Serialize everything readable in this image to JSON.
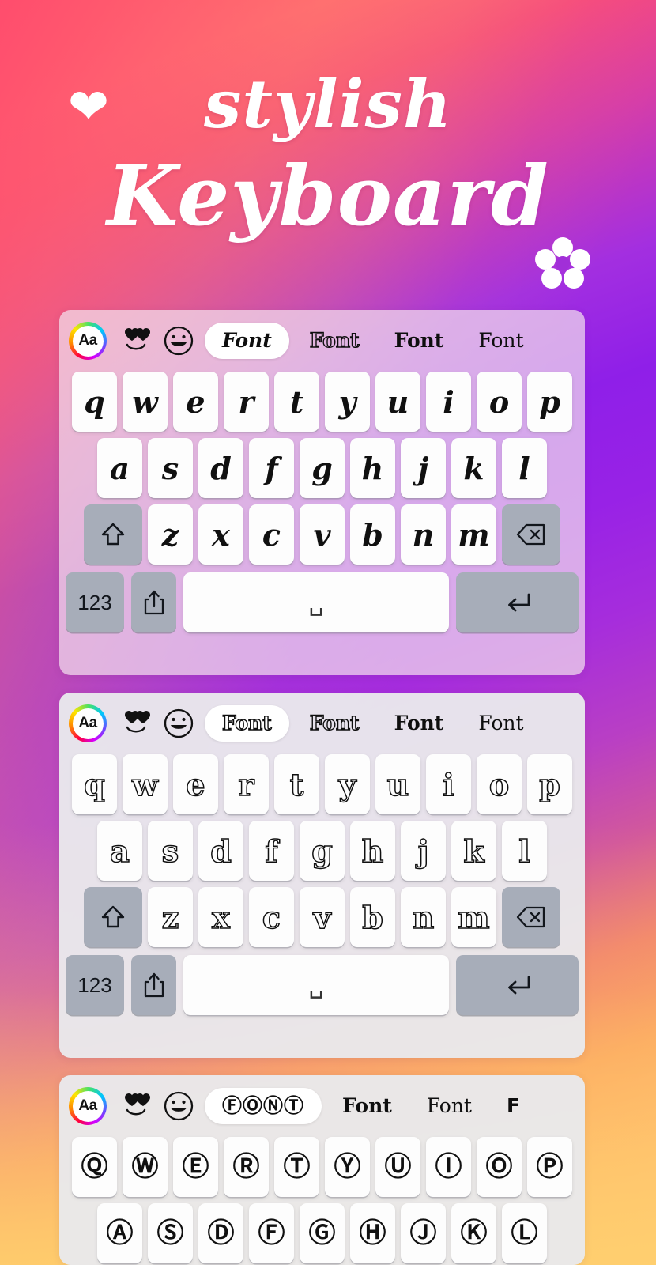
{
  "hero": {
    "title_line1": "stylish",
    "title_line2": "Keyboard",
    "heart_icon": "heart-icon",
    "flower_icon": "flower-icon"
  },
  "theme": {
    "gradient_top_left": "#ff4d6d",
    "gradient_top_right": "#8f1fe8",
    "gradient_bottom_left": "#ffd87a",
    "gradient_bottom_right": "#ffb85e",
    "key_face": "#fdfdfd",
    "key_modifier": "#a7adb9",
    "text": "#101010",
    "chip_selected_bg": "#ffffff"
  },
  "toolbar": {
    "aa_label": "Aa",
    "aa_name": "font-style-button",
    "heart_eyes_label": "heart-eyes-emoji",
    "smiley_label": "smiley-emoji"
  },
  "keyboards": [
    {
      "id": "kb1",
      "style": "script",
      "chips": [
        {
          "label": "Font",
          "style": "script",
          "selected": true
        },
        {
          "label": "Font",
          "style": "outline",
          "selected": false
        },
        {
          "label": "Font",
          "style": "bold",
          "selected": false
        },
        {
          "label": "Font",
          "style": "serif",
          "selected": false
        }
      ],
      "row1": [
        "q",
        "w",
        "e",
        "r",
        "t",
        "y",
        "u",
        "i",
        "o",
        "p"
      ],
      "row2": [
        "a",
        "s",
        "d",
        "f",
        "g",
        "h",
        "j",
        "k",
        "l"
      ],
      "row3": [
        "z",
        "x",
        "c",
        "v",
        "b",
        "n",
        "m"
      ],
      "shift_icon": "shift-icon",
      "backspace_icon": "backspace-icon",
      "numbers_label": "123",
      "share_icon": "share-icon",
      "space_label": "␣",
      "enter_icon": "return-icon"
    },
    {
      "id": "kb2",
      "style": "outline",
      "chips": [
        {
          "label": "Font",
          "style": "outline",
          "selected": true
        },
        {
          "label": "Font",
          "style": "outline",
          "selected": false
        },
        {
          "label": "Font",
          "style": "bold",
          "selected": false
        },
        {
          "label": "Font",
          "style": "serif",
          "selected": false
        }
      ],
      "row1": [
        "q",
        "w",
        "e",
        "r",
        "t",
        "y",
        "u",
        "i",
        "o",
        "p"
      ],
      "row2": [
        "a",
        "s",
        "d",
        "f",
        "g",
        "h",
        "j",
        "k",
        "l"
      ],
      "row3": [
        "z",
        "x",
        "c",
        "v",
        "b",
        "n",
        "m"
      ],
      "shift_icon": "shift-icon",
      "backspace_icon": "backspace-icon",
      "numbers_label": "123",
      "share_icon": "share-icon",
      "space_label": "␣",
      "enter_icon": "return-icon"
    },
    {
      "id": "kb3",
      "style": "circled",
      "chips": [
        {
          "label": "ⒻⓄⓃⓉ",
          "style": "circled",
          "selected": true
        },
        {
          "label": "Font",
          "style": "bold",
          "selected": false
        },
        {
          "label": "Font",
          "style": "serif",
          "selected": false
        },
        {
          "label": "F",
          "style": "circled",
          "selected": false
        }
      ],
      "row1": [
        "Ⓠ",
        "Ⓦ",
        "Ⓔ",
        "Ⓡ",
        "Ⓣ",
        "Ⓨ",
        "Ⓤ",
        "Ⓘ",
        "Ⓞ",
        "Ⓟ"
      ],
      "row2": [
        "Ⓐ",
        "Ⓢ",
        "Ⓓ",
        "Ⓕ",
        "Ⓖ",
        "Ⓗ",
        "Ⓙ",
        "Ⓚ",
        "Ⓛ"
      ]
    }
  ]
}
